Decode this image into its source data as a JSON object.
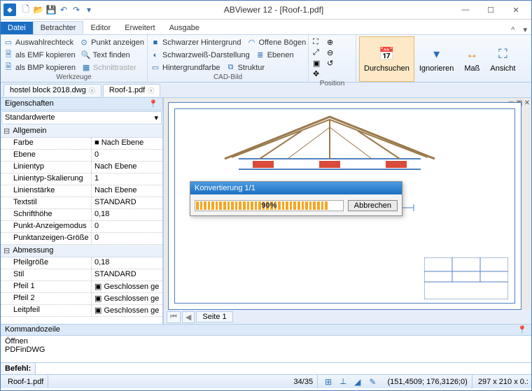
{
  "title": "ABViewer 12 - [Roof-1.pdf]",
  "qat_icons": [
    "new",
    "open",
    "save",
    "undo",
    "redo",
    "more"
  ],
  "window_buttons": {
    "min": "—",
    "max": "☐",
    "close": "✕"
  },
  "ribbon_tabs": {
    "file": "Datei",
    "list": [
      "Betrachter",
      "Editor",
      "Erweitert",
      "Ausgabe"
    ],
    "active": "Betrachter"
  },
  "ribbon": {
    "werkzeuge": {
      "label": "Werkzeuge",
      "items": [
        [
          "Auswahlrechteck",
          "Punkt anzeigen"
        ],
        [
          "als EMF kopieren",
          "Text finden"
        ],
        [
          "als BMP kopieren",
          "Schnittraster"
        ]
      ]
    },
    "cadbild": {
      "label": "CAD-Bild",
      "items": [
        [
          "Schwarzer Hintergrund",
          "Offene Bögen"
        ],
        [
          "Schwarzweiß-Darstellung",
          "Ebenen"
        ],
        [
          "Hintergrundfarbe",
          "Struktur"
        ]
      ]
    },
    "position": {
      "label": "Position"
    },
    "bigs": [
      {
        "label": "Durchsuchen",
        "active": true
      },
      {
        "label": "Ignorieren"
      },
      {
        "label": "Maß"
      },
      {
        "label": "Ansicht"
      }
    ]
  },
  "doc_tabs": [
    {
      "label": "hostel block 2018.dwg",
      "active": false
    },
    {
      "label": "Roof-1.pdf",
      "active": true
    }
  ],
  "properties": {
    "title": "Eigenschaften",
    "selector": "Standardwerte",
    "cats": [
      {
        "name": "Allgemein",
        "rows": [
          {
            "k": "Farbe",
            "v": "■ Nach Ebene"
          },
          {
            "k": "Ebene",
            "v": "0"
          },
          {
            "k": "Linientyp",
            "v": "Nach Ebene"
          },
          {
            "k": "Linientyp-Skalierung",
            "v": "1"
          },
          {
            "k": "Linienstärke",
            "v": "Nach Ebene"
          },
          {
            "k": "Textstil",
            "v": "STANDARD"
          },
          {
            "k": "Schrifthöhe",
            "v": "0,18"
          },
          {
            "k": "Punkt-Anzeigemodus",
            "v": "0"
          },
          {
            "k": "Punktanzeigen-Größe",
            "v": "0"
          }
        ]
      },
      {
        "name": "Abmessung",
        "rows": [
          {
            "k": "Pfeilgröße",
            "v": "0,18"
          },
          {
            "k": "Stil",
            "v": "STANDARD"
          },
          {
            "k": "Pfeil 1",
            "v": "▣ Geschlossen ge"
          },
          {
            "k": "Pfeil 2",
            "v": "▣ Geschlossen ge"
          },
          {
            "k": "Leitpfeil",
            "v": "▣ Geschlossen ge"
          }
        ]
      }
    ]
  },
  "page_tab": "Seite 1",
  "dialog": {
    "title": "Konvertierung 1/1",
    "percent": "90%",
    "cancel": "Abbrechen"
  },
  "command": {
    "title": "Kommandozeile",
    "log": [
      "Öffnen",
      "PDFinDWG"
    ],
    "prompt": "Befehl:"
  },
  "status": {
    "file": "Roof-1.pdf",
    "pages": "34/35",
    "coord": "(151,4509; 176,3126;0)",
    "dims": "297 x 210 x 0.:"
  }
}
